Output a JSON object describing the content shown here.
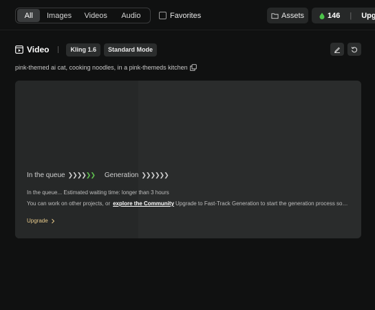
{
  "filters": {
    "tabs": [
      {
        "label": "All",
        "active": true
      },
      {
        "label": "Images",
        "active": false
      },
      {
        "label": "Videos",
        "active": false
      },
      {
        "label": "Audio",
        "active": false
      }
    ],
    "favorites_label": "Favorites",
    "favorites_checked": false
  },
  "header_actions": {
    "assets_label": "Assets",
    "credits": "146",
    "upgrade_label": "Upgra"
  },
  "task": {
    "title": "Video",
    "model_chip": "Kling 1.6",
    "mode_chip": "Standard Mode",
    "prompt": "pink-themed ai cat, cooking noodles, in a pink-themeds kitchen"
  },
  "queue_card": {
    "queue_label": "In the queue",
    "queue_arrows": "❯❯❯❯",
    "queue_arrows_done": "❯❯",
    "generation_label": "Generation",
    "generation_arrows": "❯❯❯❯❯❯",
    "wait_text": "In the queue... Estimated waiting time: longer than 3 hours",
    "work_prefix": "You can work on other projects, or",
    "community_link": "explore the Community",
    "work_suffix": "Upgrade to Fast-Track Generation to start the generation process sooner",
    "upgrade_label": "Upgrade"
  },
  "colors": {
    "background": "#101111",
    "card": "#2a2c2c",
    "progress_done": "#5fbf4f",
    "credit_icon": "#4cc34a",
    "upgrade_accent": "#e6c98a"
  },
  "icons": [
    "folder-icon",
    "credit-drop-icon",
    "video-icon",
    "edit-icon",
    "retry-icon",
    "copy-icon",
    "chevron-right-icon"
  ]
}
